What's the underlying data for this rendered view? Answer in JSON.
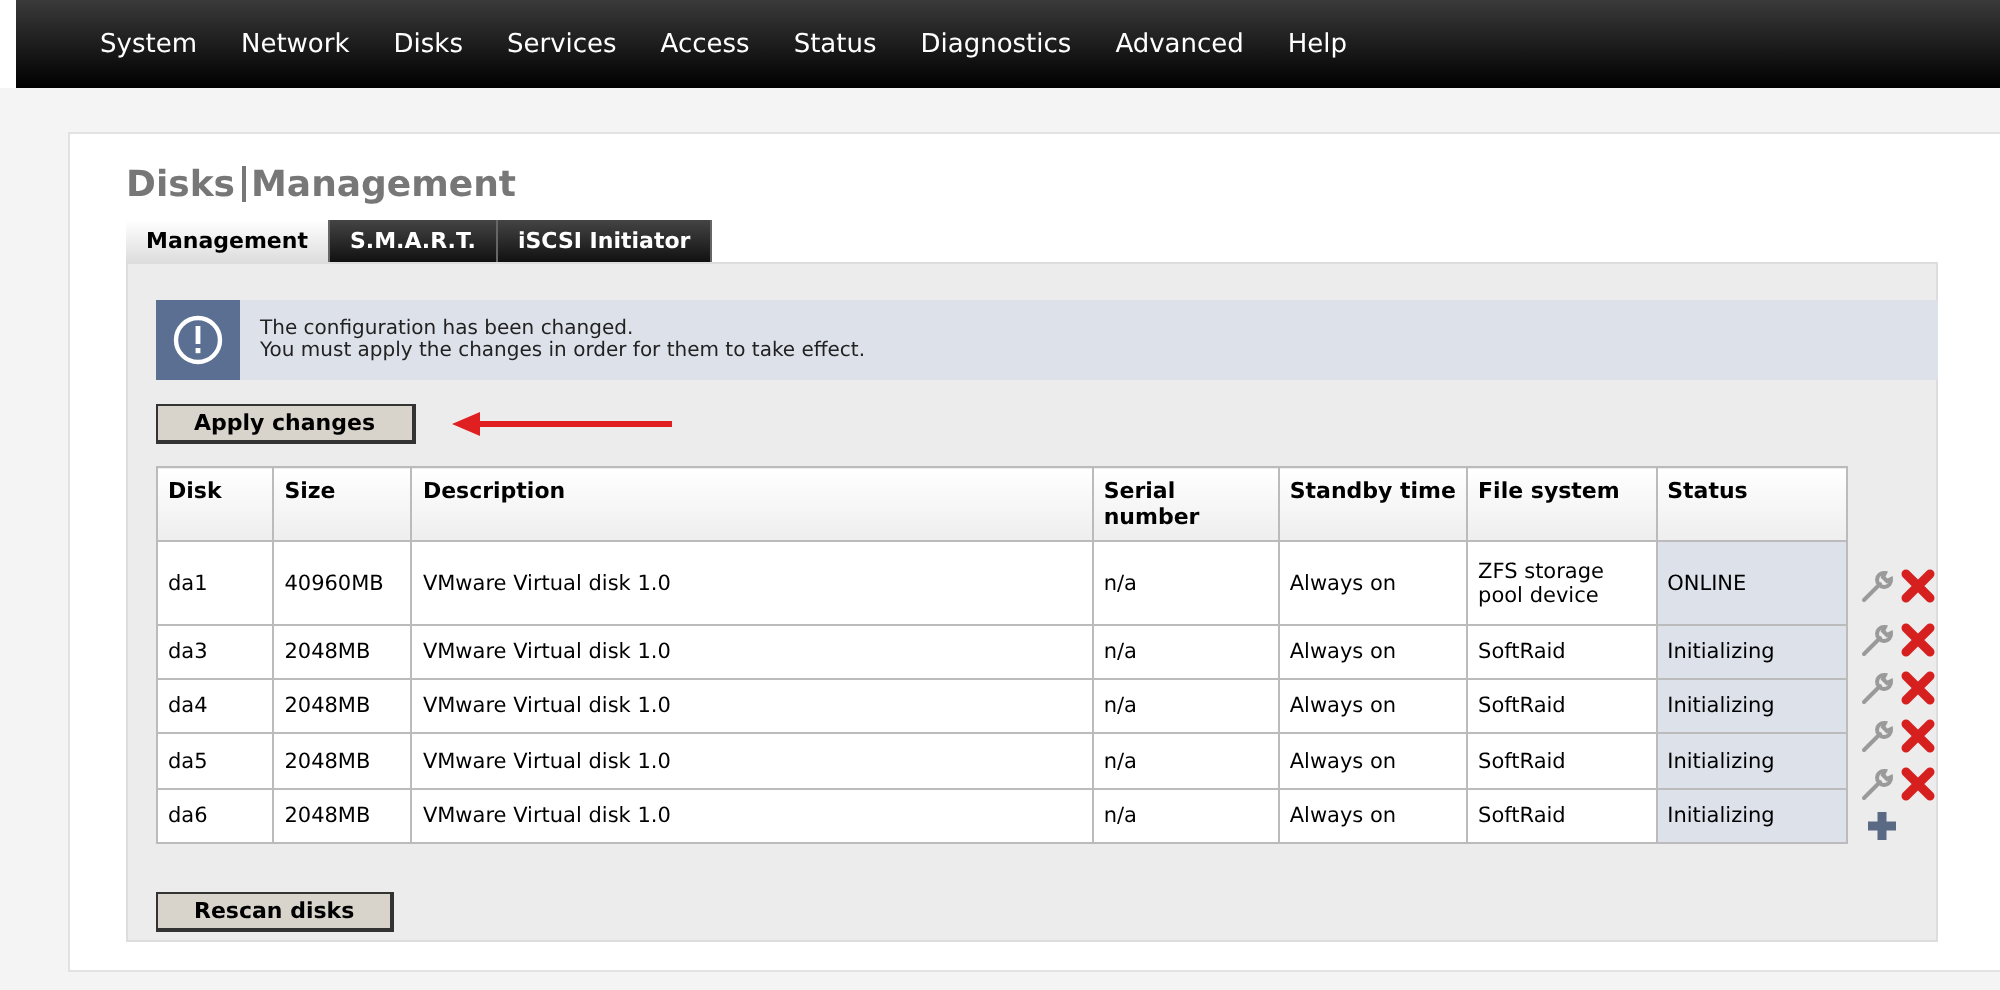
{
  "menu": [
    {
      "label": "System"
    },
    {
      "label": "Network"
    },
    {
      "label": "Disks"
    },
    {
      "label": "Services"
    },
    {
      "label": "Access"
    },
    {
      "label": "Status"
    },
    {
      "label": "Diagnostics"
    },
    {
      "label": "Advanced"
    },
    {
      "label": "Help"
    }
  ],
  "page_title": {
    "section": "Disks",
    "page": "Management"
  },
  "tabs": [
    {
      "label": "Management",
      "selected": true
    },
    {
      "label": "S.M.A.R.T.",
      "selected": false
    },
    {
      "label": "iSCSI Initiator",
      "selected": false
    }
  ],
  "notice": {
    "lines": [
      "The configuration has been changed.",
      "You must apply the changes in order for them to take effect."
    ]
  },
  "apply_button": "Apply changes",
  "table": {
    "columns": [
      "Disk",
      "Size",
      "Description",
      "Serial number",
      "Standby time",
      "File system",
      "Status"
    ],
    "rows": [
      {
        "cells": [
          "da1",
          "40960MB",
          "VMware Virtual disk 1.0",
          "n/a",
          "Always on",
          "ZFS storage pool device",
          "ONLINE"
        ]
      },
      {
        "cells": [
          "da3",
          "2048MB",
          "VMware Virtual disk 1.0",
          "n/a",
          "Always on",
          "SoftRaid",
          "Initializing"
        ]
      },
      {
        "cells": [
          "da4",
          "2048MB",
          "VMware Virtual disk 1.0",
          "n/a",
          "Always on",
          "SoftRaid",
          "Initializing"
        ]
      },
      {
        "cells": [
          "da5",
          "2048MB",
          "VMware Virtual disk 1.0",
          "n/a",
          "Always on",
          "SoftRaid",
          "Initializing"
        ]
      },
      {
        "cells": [
          "da6",
          "2048MB",
          "VMware Virtual disk 1.0",
          "n/a",
          "Always on",
          "SoftRaid",
          "Initializing"
        ]
      }
    ]
  },
  "rescan_button": "Rescan disks"
}
